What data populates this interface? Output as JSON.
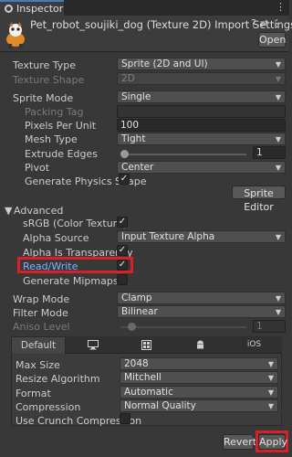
{
  "window": {
    "tab_title": "Inspector",
    "tabbar_menu_icon": "kebab-menu-icon"
  },
  "header": {
    "title": "Pet_robot_soujiki_dog (Texture 2D) Import Settings",
    "open_button": "Open",
    "icons": [
      "help-icon",
      "preset-icon",
      "kebab-menu-icon"
    ]
  },
  "fields": {
    "texture_type": {
      "label": "Texture Type",
      "value": "Sprite (2D and UI)"
    },
    "texture_shape": {
      "label": "Texture Shape",
      "value": "2D"
    },
    "sprite_mode": {
      "label": "Sprite Mode",
      "value": "Single"
    },
    "packing_tag": {
      "label": "Packing Tag",
      "value": ""
    },
    "pixels_per_unit": {
      "label": "Pixels Per Unit",
      "value": "100"
    },
    "mesh_type": {
      "label": "Mesh Type",
      "value": "Tight"
    },
    "extrude_edges": {
      "label": "Extrude Edges",
      "value": "1"
    },
    "pivot": {
      "label": "Pivot",
      "value": "Center"
    },
    "generate_physics_shape": {
      "label": "Generate Physics Shape",
      "checked": true
    },
    "sprite_editor_button": "Sprite Editor"
  },
  "advanced": {
    "header": "Advanced",
    "srgb": {
      "label": "sRGB (Color Texture)",
      "checked": true
    },
    "alpha_source": {
      "label": "Alpha Source",
      "value": "Input Texture Alpha"
    },
    "alpha_is_transparency": {
      "label": "Alpha Is Transparency",
      "checked": true
    },
    "read_write": {
      "label": "Read/Write",
      "checked": true
    },
    "generate_mipmaps": {
      "label": "Generate Mipmaps",
      "checked": false
    }
  },
  "wrap": {
    "wrap_mode": {
      "label": "Wrap Mode",
      "value": "Clamp"
    },
    "filter_mode": {
      "label": "Filter Mode",
      "value": "Bilinear"
    },
    "aniso_level": {
      "label": "Aniso Level",
      "value": "1"
    }
  },
  "platforms": {
    "tabs": [
      {
        "label": "Default",
        "icon": ""
      },
      {
        "label": "",
        "icon": "monitor-icon"
      },
      {
        "label": "",
        "icon": "webgl-icon"
      },
      {
        "label": "",
        "icon": "android-icon"
      },
      {
        "label": "iOS",
        "icon": ""
      }
    ],
    "max_size": {
      "label": "Max Size",
      "value": "2048"
    },
    "resize_algorithm": {
      "label": "Resize Algorithm",
      "value": "Mitchell"
    },
    "format": {
      "label": "Format",
      "value": "Automatic"
    },
    "compression": {
      "label": "Compression",
      "value": "Normal Quality"
    },
    "use_crunch": {
      "label": "Use Crunch Compression",
      "checked": false
    }
  },
  "footer": {
    "revert_button": "Revert",
    "apply_button": "Apply"
  },
  "colors": {
    "highlight": "#d9202a",
    "link_text": "#7fb2ff"
  }
}
